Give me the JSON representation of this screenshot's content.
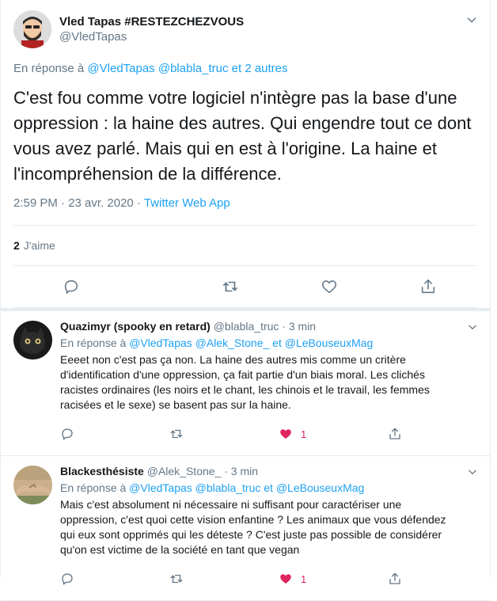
{
  "main_tweet": {
    "display_name": "Vled Tapas #RESTEZCHEZVOUS",
    "handle": "@VledTapas",
    "reply_to_prefix": "En réponse à",
    "reply_to_mentions": [
      "@VledTapas",
      "@blabla_truc",
      "et 2 autres"
    ],
    "text": "C'est fou comme votre logiciel n'intègre pas la base d'une oppression : la haine des autres. Qui engendre tout ce dont vous avez parlé. Mais qui en est à l'origine. La haine et l'incompréhension de la différence.",
    "timestamp": "2:59 PM · 23 avr. 2020 · ",
    "source_app": "Twitter Web App",
    "likes_count": "2",
    "likes_label": "J'aime",
    "icons": [
      "reply-icon",
      "retweet-icon",
      "like-icon",
      "share-icon",
      "caret-down-icon"
    ]
  },
  "replies": [
    {
      "display_name": "Quazimyr (spooky en retard)",
      "handle": "@blabla_truc",
      "time": " · 3 min",
      "reply_to_prefix": "En réponse à ",
      "reply_to_mentions": [
        "@VledTapas",
        "@Alek_Stone_",
        "et",
        "@LeBouseuxMag"
      ],
      "text": "Eeeet non c'est pas ça non. La haine des autres mis comme un critère d'identification d'une oppression, ça fait partie d'un biais moral. Les clichés racistes ordinaires (les noirs et le chant, les chinois et le travail, les femmes racisées et le sexe) se basent pas sur la haine.",
      "like_count": "1",
      "liked": true
    },
    {
      "display_name": "Blackesthésiste",
      "handle": "@Alek_Stone_",
      "time": " · 3 min",
      "reply_to_prefix": "En réponse à ",
      "reply_to_mentions": [
        "@VledTapas",
        "@blabla_truc",
        "et",
        "@LeBouseuxMag"
      ],
      "text": "Mais c'est absolument ni nécessaire ni suffisant pour caractériser une oppression, c'est quoi cette vision enfantine ? Les animaux que vous défendez qui eux sont opprimés qui les déteste ? C'est juste pas possible de considérer qu'on est victime de la société en tant que vegan",
      "like_count": "1",
      "liked": true
    }
  ],
  "colors": {
    "accent": "#1da1f2",
    "muted": "#657786",
    "text": "#14171a",
    "like": "#e0245e",
    "border": "#e6ecf0"
  }
}
